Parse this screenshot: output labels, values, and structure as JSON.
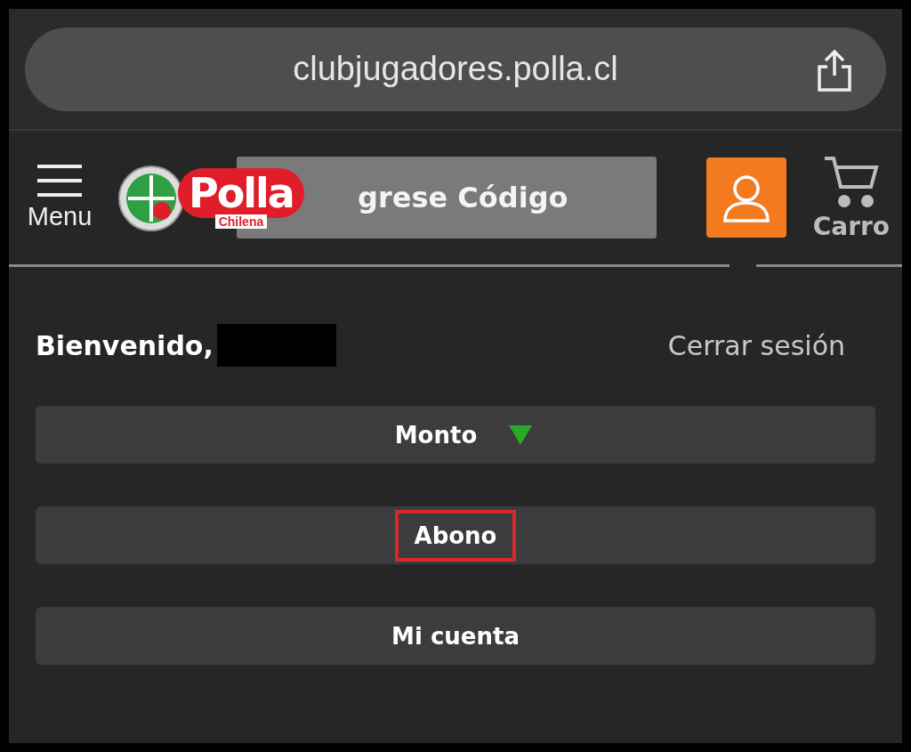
{
  "browser": {
    "url": "clubjugadores.polla.cl"
  },
  "header": {
    "menu_label": "Menu",
    "logo": {
      "title": "Polla",
      "subtitle": "Chilena"
    },
    "code_field": {
      "placeholder": "grese Código"
    },
    "cart_label": "Carro"
  },
  "welcome": {
    "greeting": "Bienvenido,",
    "logout": "Cerrar sesión"
  },
  "menu_items": [
    {
      "label": "Monto",
      "expanded": false,
      "highlighted": false
    },
    {
      "label": "Abono",
      "highlighted": true
    },
    {
      "label": "Mi cuenta",
      "highlighted": false
    }
  ]
}
